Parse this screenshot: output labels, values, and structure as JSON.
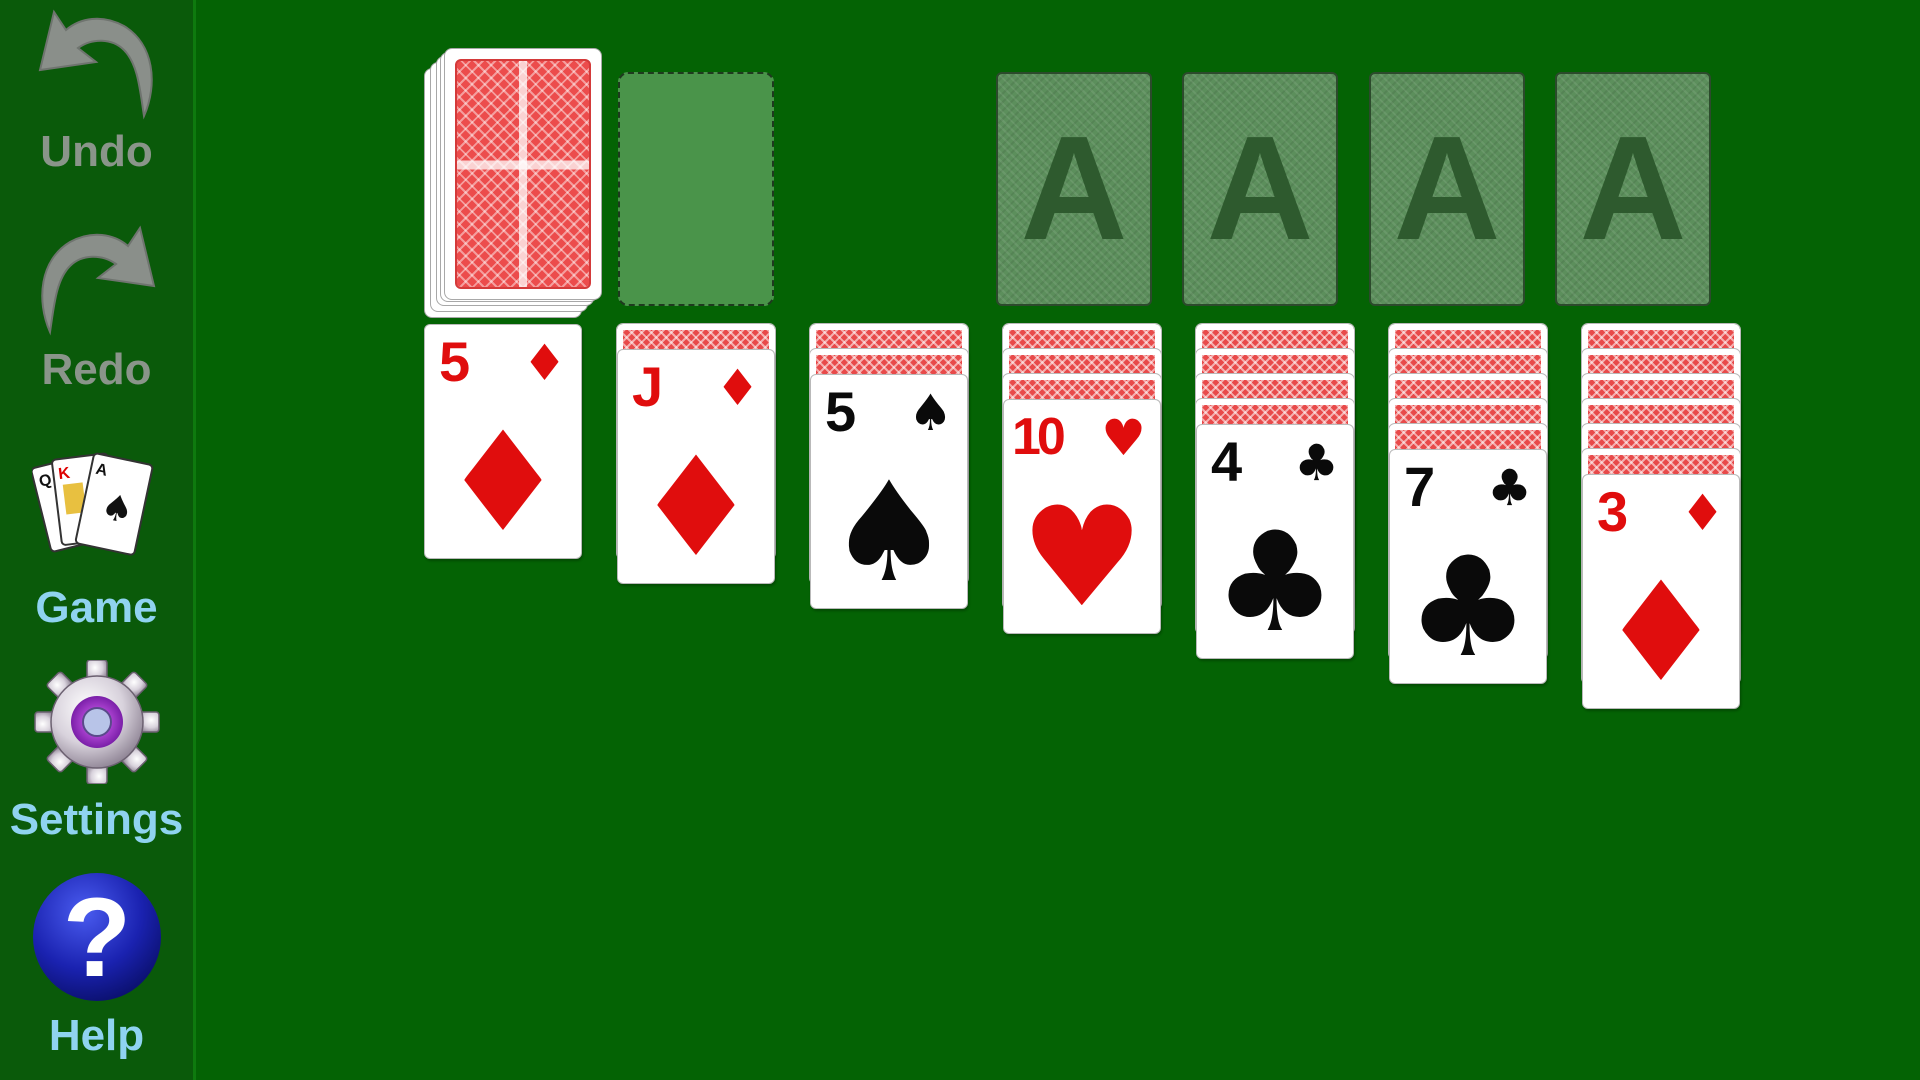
{
  "sidebar": {
    "undo_label": "Undo",
    "redo_label": "Redo",
    "game_label": "Game",
    "settings_label": "Settings",
    "help_label": "Help",
    "help_glyph": "?",
    "icons": [
      "undo-arrow-icon",
      "redo-arrow-icon",
      "playing-cards-icon",
      "gear-icon",
      "question-mark-icon"
    ]
  },
  "colors": {
    "felt": "#046304",
    "sidebar": "#0a5a0a",
    "card_back": "#e84a4a",
    "red_suit": "#e00d0d",
    "black_suit": "#0a0a0a",
    "foundation": "#5c8f5c"
  },
  "foundations": [
    "A",
    "A",
    "A",
    "A"
  ],
  "tableau": [
    {
      "face_down": 0,
      "card": {
        "rank": "5",
        "suit": "♦",
        "color": "red"
      }
    },
    {
      "face_down": 1,
      "card": {
        "rank": "J",
        "suit": "♦",
        "color": "red"
      }
    },
    {
      "face_down": 2,
      "card": {
        "rank": "5",
        "suit": "♠",
        "color": "black"
      }
    },
    {
      "face_down": 3,
      "card": {
        "rank": "10",
        "suit": "♥",
        "color": "red"
      }
    },
    {
      "face_down": 4,
      "card": {
        "rank": "4",
        "suit": "♣",
        "color": "black"
      }
    },
    {
      "face_down": 5,
      "card": {
        "rank": "7",
        "suit": "♣",
        "color": "black"
      }
    },
    {
      "face_down": 6,
      "card": {
        "rank": "3",
        "suit": "♦",
        "color": "red"
      }
    }
  ]
}
